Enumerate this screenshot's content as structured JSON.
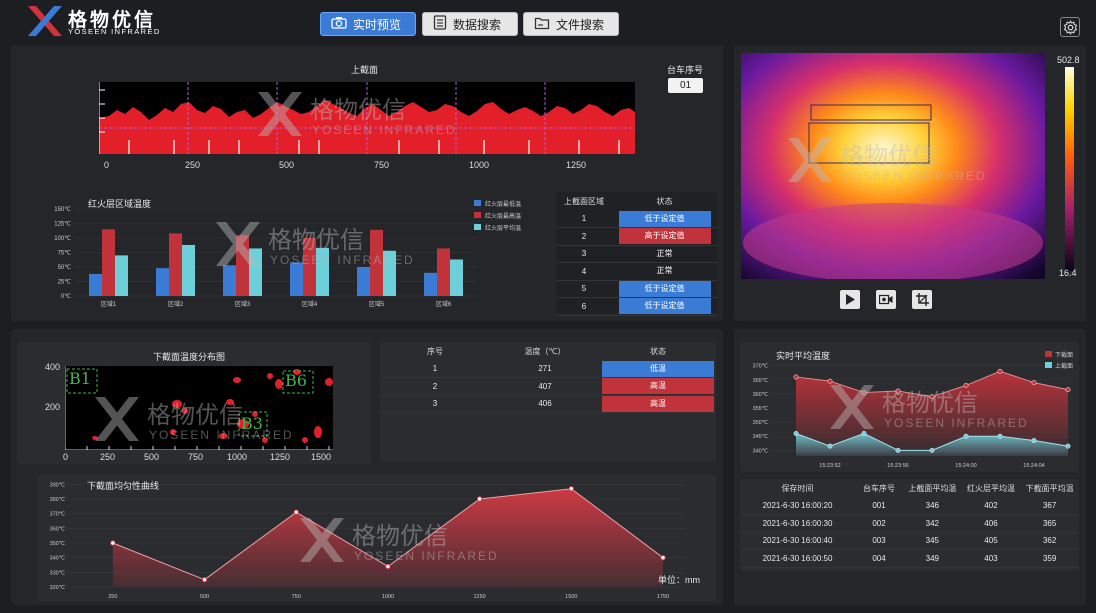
{
  "header": {
    "brand_cn": "格物优信",
    "brand_en": "YOSEEN INFRARED",
    "buttons": [
      {
        "label": "实时预览",
        "icon": "camera-icon"
      },
      {
        "label": "数据搜索",
        "icon": "document-icon"
      },
      {
        "label": "文件搜索",
        "icon": "folder-icon"
      }
    ]
  },
  "upper": {
    "title": "上截面",
    "car_label": "台车序号",
    "car_value": "01",
    "x_ticks": [
      "0",
      "250",
      "500",
      "750",
      "1000",
      "1250"
    ]
  },
  "fire_chart": {
    "title": "红火层区域温度",
    "y_ticks": [
      "150℃",
      "125℃",
      "100℃",
      "75℃",
      "50℃",
      "25℃",
      "0℃"
    ],
    "legend": [
      "红火层最低温",
      "红火层最高温",
      "红火层平均温"
    ],
    "colors": [
      "#3a7bd5",
      "#c0333a",
      "#6ccfda"
    ],
    "categories": [
      "区域1",
      "区域2",
      "区域3",
      "区域4",
      "区域5",
      "区域6"
    ],
    "chart_data": {
      "type": "bar",
      "categories": [
        "区域1",
        "区域2",
        "区域3",
        "区域4",
        "区域5",
        "区域6"
      ],
      "series": [
        {
          "name": "红火层最低温",
          "values": [
            38,
            48,
            53,
            58,
            50,
            40
          ]
        },
        {
          "name": "红火层最高温",
          "values": [
            115,
            108,
            105,
            100,
            114,
            82
          ]
        },
        {
          "name": "红火层平均温",
          "values": [
            70,
            88,
            82,
            83,
            78,
            63
          ]
        }
      ],
      "ylim": [
        0,
        150
      ]
    }
  },
  "region_table": {
    "headers": [
      "上截面区域",
      "状态"
    ],
    "rows": [
      {
        "id": "1",
        "status": "低于设定值",
        "kind": "blue"
      },
      {
        "id": "2",
        "status": "高于设定值",
        "kind": "red"
      },
      {
        "id": "3",
        "status": "正常",
        "kind": "none"
      },
      {
        "id": "4",
        "status": "正常",
        "kind": "none"
      },
      {
        "id": "5",
        "status": "低于设定值",
        "kind": "blue"
      },
      {
        "id": "6",
        "status": "低于设定值",
        "kind": "blue"
      }
    ]
  },
  "thermal": {
    "max": "502.8",
    "min": "16.4",
    "controls": [
      "play-icon",
      "record-icon",
      "crop-icon"
    ]
  },
  "lower_map": {
    "title": "下截面温度分布图",
    "y_ticks": [
      "400",
      "200"
    ],
    "x_ticks": [
      "0",
      "250",
      "500",
      "750",
      "1000",
      "1250",
      "1500"
    ],
    "boxes": [
      "B1",
      "B6",
      "B3"
    ]
  },
  "lower_table": {
    "headers": [
      "序号",
      "温度（℃）",
      "状态"
    ],
    "rows": [
      {
        "id": "1",
        "temp": "271",
        "status": "低温",
        "kind": "blue"
      },
      {
        "id": "2",
        "temp": "407",
        "status": "高温",
        "kind": "red"
      },
      {
        "id": "3",
        "temp": "406",
        "status": "高温",
        "kind": "red"
      }
    ]
  },
  "uniformity": {
    "title": "下截面均匀性曲线",
    "unit": "单位：mm",
    "y_ticks": [
      "390℃",
      "380℃",
      "370℃",
      "360℃",
      "350℃",
      "340℃",
      "330℃",
      "320℃"
    ],
    "chart_data": {
      "type": "area",
      "x": [
        250,
        500,
        750,
        1000,
        1250,
        1500,
        1750
      ],
      "values": [
        350,
        325,
        371,
        334,
        380,
        387,
        340
      ],
      "ylim": [
        320,
        395
      ]
    }
  },
  "realtime": {
    "title": "实时平均温度",
    "legend": [
      "下截面",
      "上截面"
    ],
    "y_ticks": [
      "370℃",
      "365℃",
      "360℃",
      "355℃",
      "350℃",
      "345℃",
      "340℃"
    ],
    "x_ticks": [
      "15:23:52",
      "15:23:56",
      "15:24:00",
      "15:24:04"
    ],
    "chart_data": {
      "type": "area",
      "series": [
        {
          "name": "下截面",
          "values": [
            366,
            364.5,
            360.5,
            361,
            359,
            363,
            368,
            364,
            361.5
          ]
        },
        {
          "name": "上截面",
          "values": [
            346,
            341.5,
            346,
            340,
            340,
            345,
            345,
            343.5,
            341.5
          ]
        }
      ],
      "ylim": [
        338,
        372
      ]
    }
  },
  "history": {
    "headers": [
      "保存时间",
      "台车序号",
      "上截面平均温",
      "红火层平均温",
      "下截面平均温"
    ],
    "rows": [
      [
        "2021-6-30 16:00:20",
        "001",
        "346",
        "402",
        "367"
      ],
      [
        "2021-6-30 16:00:30",
        "002",
        "342",
        "406",
        "365"
      ],
      [
        "2021-6-30 16:00:40",
        "003",
        "345",
        "405",
        "362"
      ],
      [
        "2021-6-30 16:00:50",
        "004",
        "349",
        "403",
        "359"
      ]
    ]
  }
}
